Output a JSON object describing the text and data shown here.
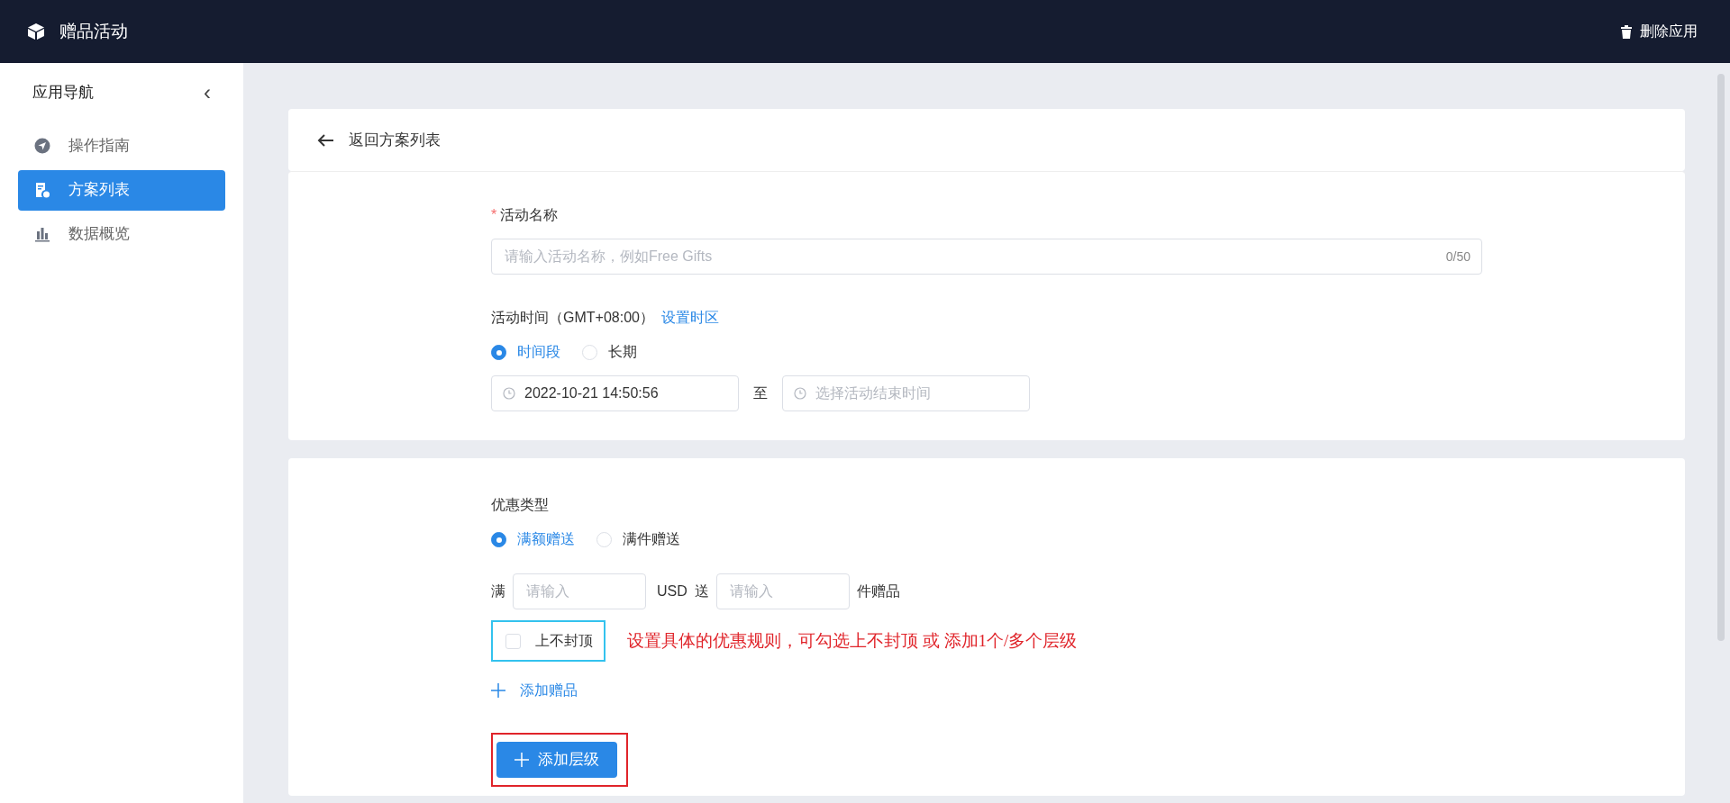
{
  "header": {
    "title": "赠品活动",
    "action": "删除应用"
  },
  "sidebar": {
    "title": "应用导航",
    "collapse": "‹",
    "items": [
      {
        "label": "操作指南",
        "kind": "compass",
        "selected": false
      },
      {
        "label": "方案列表",
        "kind": "doc",
        "selected": true
      },
      {
        "label": "数据概览",
        "kind": "chart",
        "selected": false
      }
    ]
  },
  "back": "返回方案列表",
  "activity": {
    "name_label": "活动名称",
    "required_mark": "*",
    "name_placeholder": "请输入活动名称，例如Free Gifts",
    "name_count": "0/50",
    "time_label": "活动时间（GMT+08:00）",
    "timezone_link": "设置时区",
    "time_options": [
      {
        "label": "时间段",
        "selected": true
      },
      {
        "label": "长期",
        "selected": false
      }
    ],
    "start_value": "2022-10-21 14:50:56",
    "separator": "至",
    "end_placeholder": "选择活动结束时间"
  },
  "discount": {
    "type_label": "优惠类型",
    "type_options": [
      {
        "label": "满额赠送",
        "selected": true
      },
      {
        "label": "满件赠送",
        "selected": false
      }
    ],
    "rule": {
      "prefix": "满",
      "amount_placeholder": "请输入",
      "currency": "USD",
      "give": "送",
      "count_placeholder": "请输入",
      "suffix": "件赠品"
    },
    "no_cap": {
      "label": "上不封顶",
      "checked": false
    },
    "add_gift": "添加赠品",
    "add_level": "添加层级"
  },
  "annotation": {
    "text": "设置具体的优惠规则，可勾选上不封顶 或 添加1个/多个层级"
  }
}
